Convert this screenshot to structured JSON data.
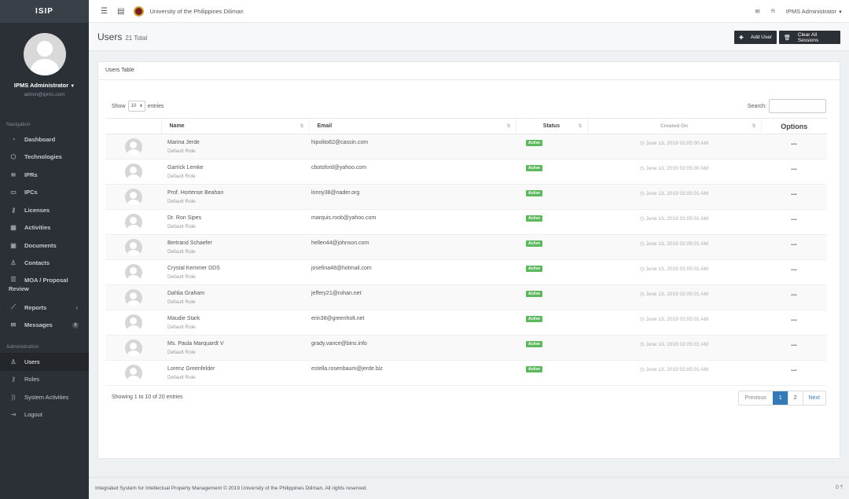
{
  "sidebar": {
    "brand": "ISIP",
    "profile": {
      "name": "IPMS Administrator",
      "email": "admin@ipms.com"
    },
    "nav_header": "Navigation",
    "nav": [
      {
        "label": "Dashboard",
        "icon": "gauge-icon"
      },
      {
        "label": "Technologies",
        "icon": "cube-icon"
      },
      {
        "label": "IPRs",
        "icon": "layers-icon"
      },
      {
        "label": "IPCs",
        "icon": "folder-icon"
      },
      {
        "label": "Licenses",
        "icon": "key-icon"
      },
      {
        "label": "Activities",
        "icon": "calendar-icon"
      },
      {
        "label": "Documents",
        "icon": "box-icon"
      },
      {
        "label": "Contacts",
        "icon": "contact-icon"
      },
      {
        "label": "MOA / Proposal",
        "label2": "Review",
        "icon": "list-icon"
      },
      {
        "label": "Reports",
        "icon": "chart-icon"
      },
      {
        "label": "Messages",
        "icon": "mail-icon",
        "badge": "0"
      }
    ],
    "admin_header": "Administration",
    "admin": [
      {
        "label": "Users",
        "icon": "user-icon"
      },
      {
        "label": "Roles",
        "icon": "key-icon"
      },
      {
        "label": "System Activities",
        "icon": "feed-icon"
      },
      {
        "label": "Logout",
        "icon": "logout-icon"
      }
    ]
  },
  "topbar": {
    "title": "University of the Philippines Diliman",
    "user": "IPMS Administrator"
  },
  "header": {
    "title": "Users",
    "total": "21 Total",
    "add_user": "Add User",
    "clear_sessions": "Clear All Sessions"
  },
  "panel": {
    "heading": "Users Table",
    "show": "Show",
    "length": "10",
    "entries": "entries",
    "search": "Search:"
  },
  "table": {
    "columns": [
      "Name",
      "Email",
      "Status",
      "Created On",
      "Options"
    ],
    "rows": [
      {
        "name": "Marina Jerde",
        "role": "Default Role",
        "email": "hipolito82@cassin.com",
        "status": "Active",
        "created": "June 13, 2019 02:05:00 AM"
      },
      {
        "name": "Garrick Lemke",
        "role": "Default Role",
        "email": "cbotsford@yahoo.com",
        "status": "Active",
        "created": "June 13, 2019 02:05:00 AM"
      },
      {
        "name": "Prof. Hortense Beahan",
        "role": "Default Role",
        "email": "lonny38@nader.org",
        "status": "Active",
        "created": "June 13, 2019 02:05:01 AM"
      },
      {
        "name": "Dr. Ron Sipes",
        "role": "Default Role",
        "email": "marquis.roob@yahoo.com",
        "status": "Active",
        "created": "June 13, 2019 02:05:01 AM"
      },
      {
        "name": "Bertrand Schaefer",
        "role": "Default Role",
        "email": "hellen44@johnson.com",
        "status": "Active",
        "created": "June 13, 2019 02:05:01 AM"
      },
      {
        "name": "Crystal Kemmer DDS",
        "role": "Default Role",
        "email": "josefina48@hotmail.com",
        "status": "Active",
        "created": "June 13, 2019 02:05:01 AM"
      },
      {
        "name": "Dahlia Graham",
        "role": "Default Role",
        "email": "jeffery21@rohan.net",
        "status": "Active",
        "created": "June 13, 2019 02:05:01 AM"
      },
      {
        "name": "Maudie Stark",
        "role": "Default Role",
        "email": "erin38@greenholt.net",
        "status": "Active",
        "created": "June 13, 2019 02:05:01 AM"
      },
      {
        "name": "Ms. Paula Marquardt V",
        "role": "Default Role",
        "email": "grady.vance@bins.info",
        "status": "Active",
        "created": "June 13, 2019 02:05:01 AM"
      },
      {
        "name": "Lorenz Greenfelder",
        "role": "Default Role",
        "email": "estella.rosenbaum@jerde.biz",
        "status": "Active",
        "created": "June 13, 2019 02:05:01 AM"
      }
    ]
  },
  "info": "Showing 1 to 10 of 20 entries",
  "pagination": {
    "previous": "Previous",
    "pages": [
      "1",
      "2"
    ],
    "next": "Next"
  },
  "footer": {
    "text": "Integrated System for Intellectual Property Management © 2019 University of the Philippines Diliman. All rights reserved.",
    "right": "0"
  }
}
